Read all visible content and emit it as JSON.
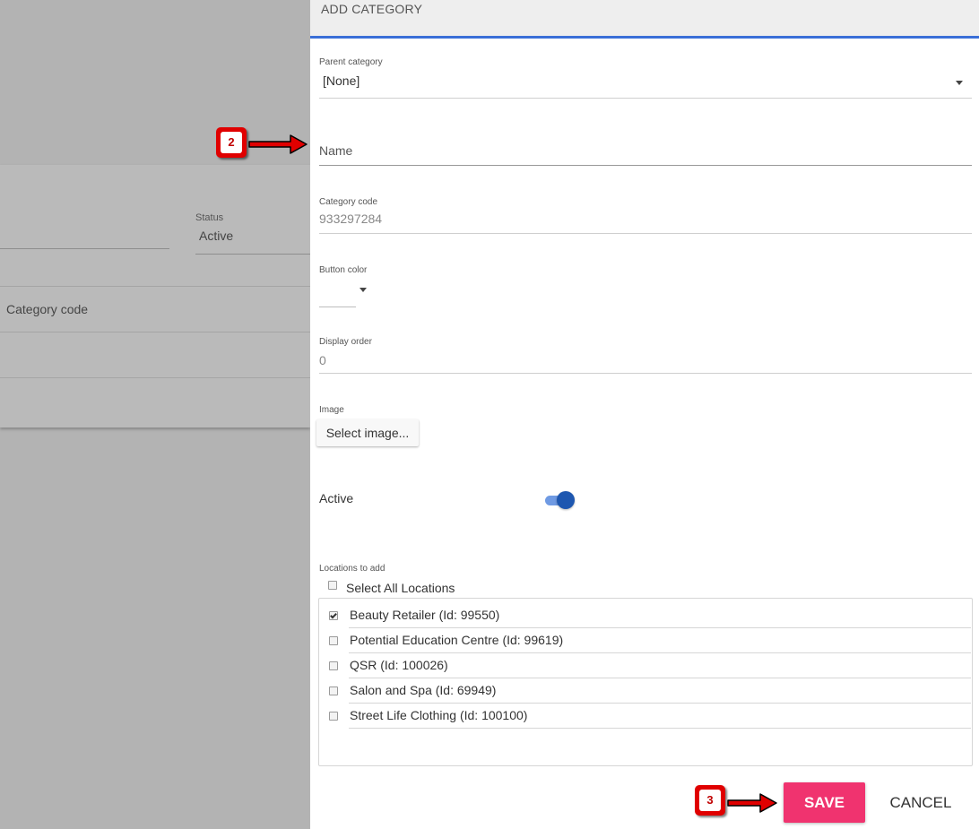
{
  "background": {
    "status_label": "Status",
    "status_value": "Active",
    "column_header": "Category code"
  },
  "dialog": {
    "title": "ADD CATEGORY",
    "parent_category": {
      "label": "Parent category",
      "value": "[None]"
    },
    "name": {
      "placeholder": "Name",
      "value": ""
    },
    "category_code": {
      "label": "Category code",
      "value": "933297284"
    },
    "button_color": {
      "label": "Button color"
    },
    "display_order": {
      "label": "Display order",
      "value": "0"
    },
    "image": {
      "label": "Image",
      "button_label": "Select image..."
    },
    "active": {
      "label": "Active",
      "enabled": true
    },
    "locations": {
      "label": "Locations to add",
      "select_all_label": "Select All Locations",
      "select_all_checked": false,
      "items": [
        {
          "label": "Beauty Retailer (Id: 99550)",
          "checked": true
        },
        {
          "label": "Potential Education Centre (Id: 99619)",
          "checked": false
        },
        {
          "label": "QSR (Id: 100026)",
          "checked": false
        },
        {
          "label": "Salon and Spa (Id: 69949)",
          "checked": false
        },
        {
          "label": "Street Life Clothing (Id: 100100)",
          "checked": false
        }
      ]
    },
    "save_label": "SAVE",
    "cancel_label": "CANCEL"
  },
  "annotations": [
    {
      "number": "2"
    },
    {
      "number": "3"
    }
  ],
  "colors": {
    "accent_blue": "#3a6fd8",
    "save_pink": "#f0336f",
    "toggle_on": "#1e57b0",
    "badge_red": "#e00000"
  }
}
